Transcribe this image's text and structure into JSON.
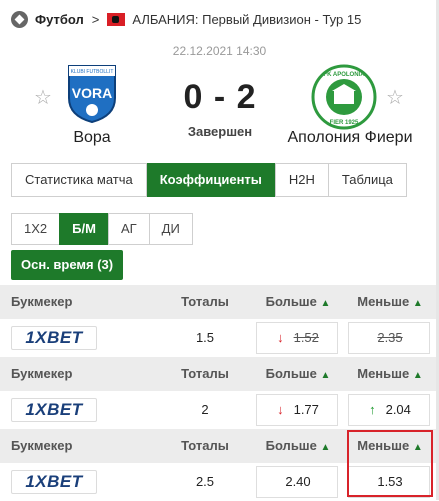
{
  "breadcrumb": {
    "sport": "Футбол",
    "separator": ">",
    "league": "АЛБАНИЯ: Первый Дивизион - Тур 15"
  },
  "match": {
    "datetime": "22.12.2021 14:30",
    "home": {
      "name": "Вора",
      "logo_text": "VORA",
      "logo_sub": "KLUBI FUTBOLLIT"
    },
    "away": {
      "name": "Аполония Фиери",
      "logo_top": "FK APOLONIA",
      "logo_bottom": "FIER 1925"
    },
    "score": "0 - 2",
    "status": "Завершен"
  },
  "tabs": [
    "Статистика матча",
    "Коэффициенты",
    "H2H",
    "Таблица"
  ],
  "active_tab": "Коэффициенты",
  "subtabs": [
    "1X2",
    "Б/М",
    "АГ",
    "ДИ"
  ],
  "active_subtab": "Б/М",
  "period": "Осн. время (3)",
  "table": {
    "headers": {
      "bookmaker": "Букмекер",
      "totals": "Тоталы",
      "over": "Больше",
      "under": "Меньше"
    },
    "rows": [
      {
        "bookmaker": "1XBET",
        "total": "1.5",
        "over": "1.52",
        "under": "2.35",
        "over_trend": "down",
        "under_trend": "none",
        "over_struck": true,
        "under_struck": true
      },
      {
        "bookmaker": "1XBET",
        "total": "2",
        "over": "1.77",
        "under": "2.04",
        "over_trend": "down",
        "under_trend": "up",
        "over_struck": false,
        "under_struck": false
      },
      {
        "bookmaker": "1XBET",
        "total": "2.5",
        "over": "2.40",
        "under": "1.53",
        "over_trend": "none",
        "under_trend": "none",
        "over_struck": false,
        "under_struck": false
      }
    ]
  },
  "icons": {
    "sport": "soccer-ball-icon",
    "flag": "albania-flag-icon",
    "favorite": "star-outline-icon",
    "sort": "triangle-up-icon",
    "down": "arrow-down-icon",
    "up": "arrow-up-icon"
  },
  "colors": {
    "accent": "#1e7a2a",
    "down": "#d8232a",
    "up": "#1e9a2f",
    "highlight": "#d8232a"
  }
}
